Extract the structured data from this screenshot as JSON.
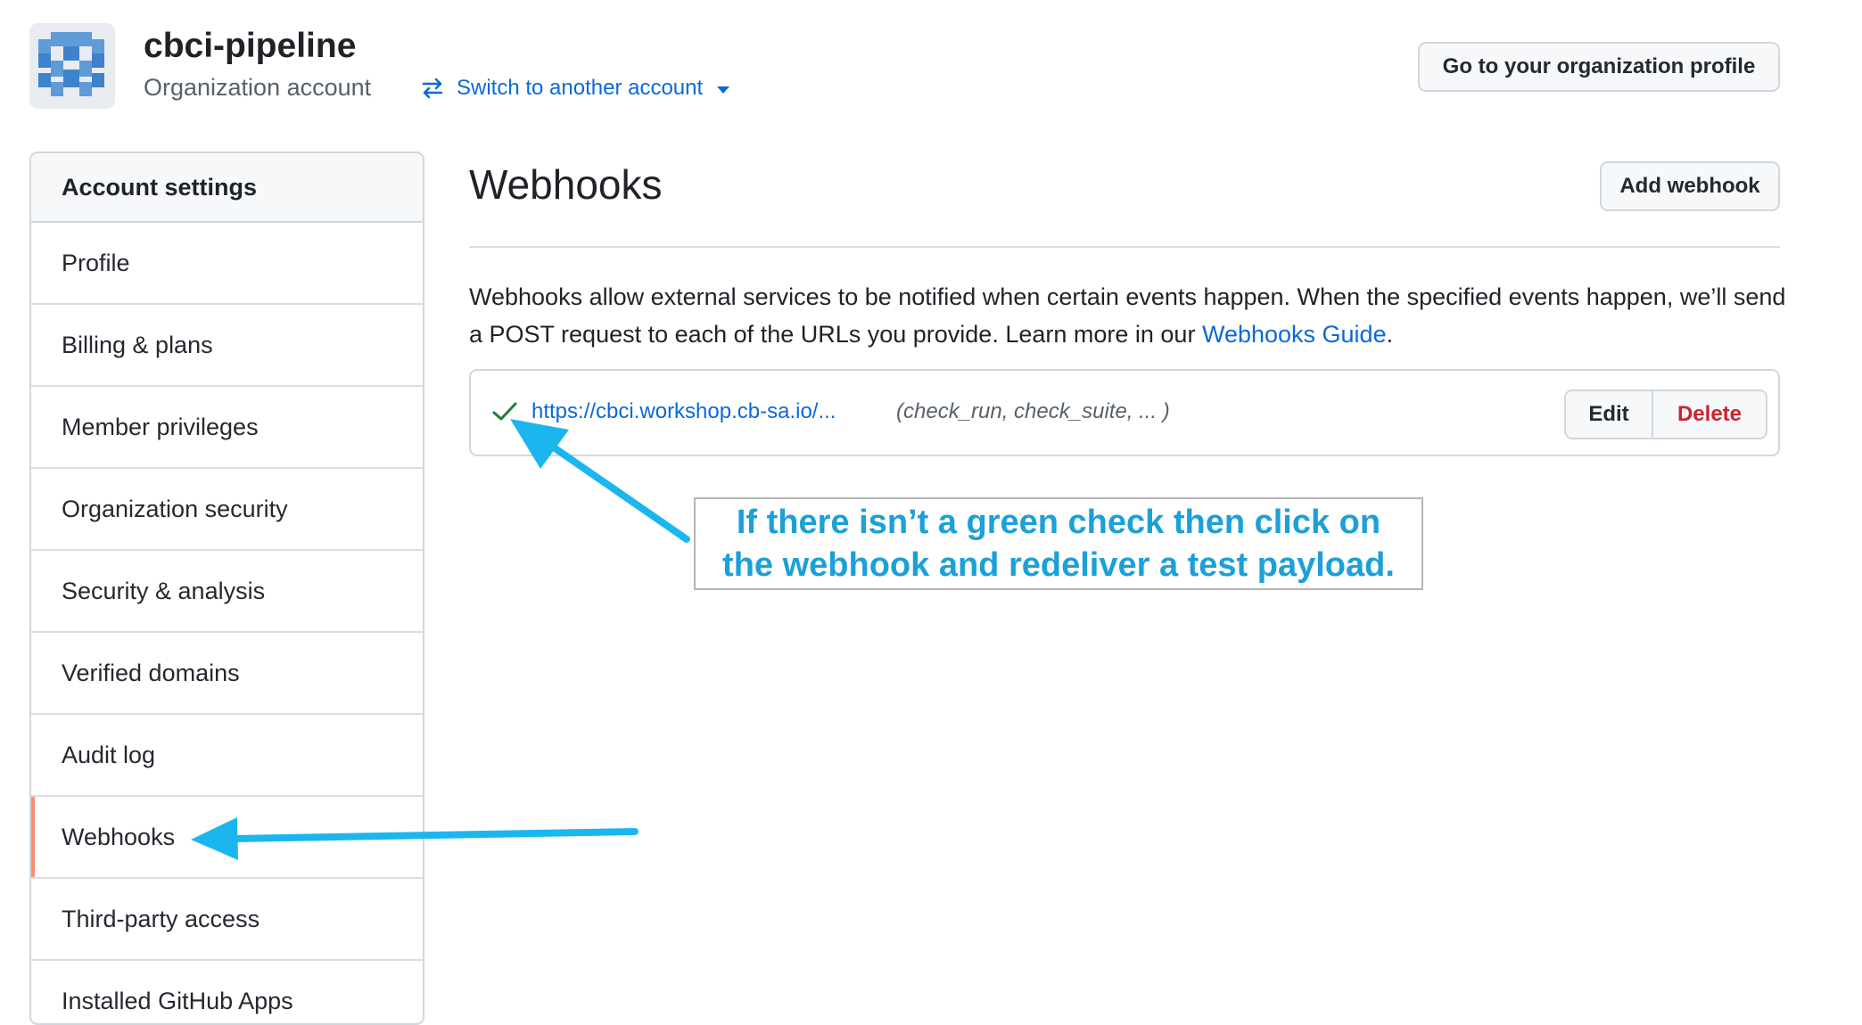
{
  "header": {
    "org_name": "cbci-pipeline",
    "org_type": "Organization account",
    "switch_account_label": "Switch to another account",
    "org_profile_button": "Go to your organization profile"
  },
  "sidebar": {
    "title": "Account settings",
    "active_item": "Webhooks",
    "items": [
      {
        "label": "Profile"
      },
      {
        "label": "Billing & plans"
      },
      {
        "label": "Member privileges"
      },
      {
        "label": "Organization security"
      },
      {
        "label": "Security & analysis"
      },
      {
        "label": "Verified domains"
      },
      {
        "label": "Audit log"
      },
      {
        "label": "Webhooks"
      },
      {
        "label": "Third-party access"
      },
      {
        "label": "Installed GitHub Apps"
      }
    ]
  },
  "main": {
    "title": "Webhooks",
    "add_button": "Add webhook",
    "description": "Webhooks allow external services to be notified when certain events happen. When the specified events happen, we’ll send a POST request to each of the URLs you provide. Learn more in our ",
    "guide_link": "Webhooks Guide",
    "description_end": ".",
    "webhook": {
      "url": "https://cbci.workshop.cb-sa.io/...",
      "events": "(check_run, check_suite, ... )",
      "status_icon": "check-icon",
      "edit_label": "Edit",
      "delete_label": "Delete"
    }
  },
  "annotation": {
    "line1": "If there isn’t a green check then click on",
    "line2": "the webhook and redeliver a test payload."
  },
  "colors": {
    "link": "#0969da",
    "success": "#1a7f37",
    "danger": "#cf222e",
    "active_marker": "#fd8c73",
    "annotation": "#1ca0d8"
  }
}
